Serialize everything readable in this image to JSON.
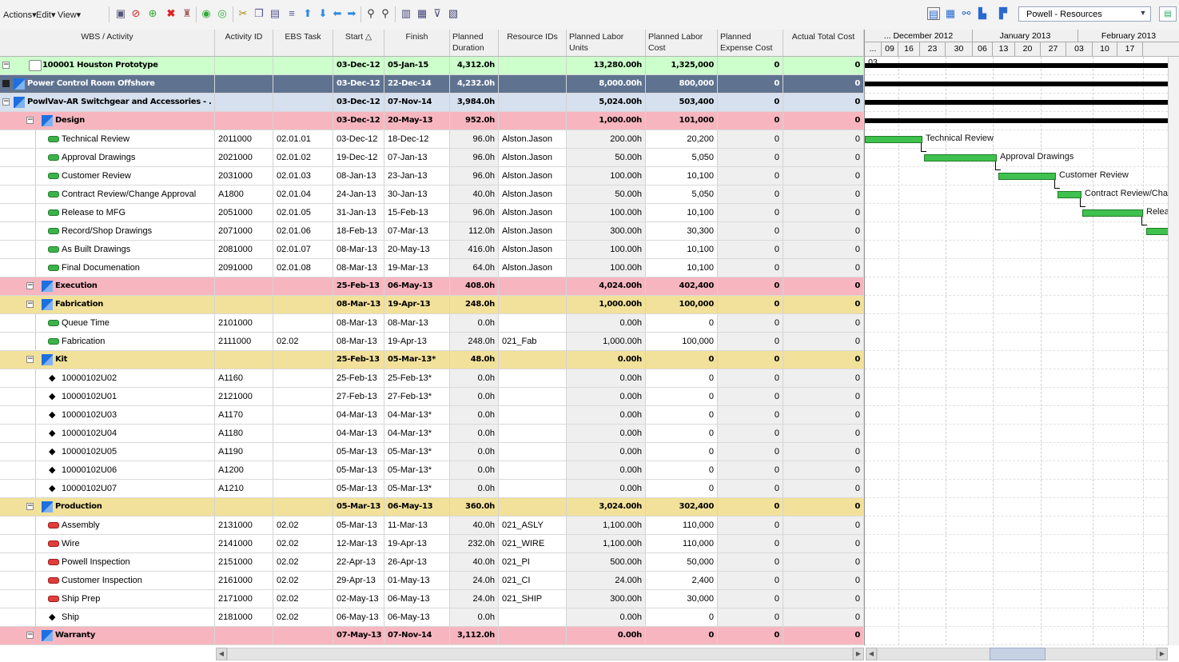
{
  "toolbar": {
    "menus": [
      "Actions",
      "Edit",
      "View"
    ],
    "layout_name": "Powell - Resources"
  },
  "colors": {
    "project_row": "#ccffcc",
    "level1_row": "#5f7390",
    "level2_row": "#d6e0ee",
    "phase_row": "#f7b6bf",
    "subphase_row": "#f2e19a",
    "bar_green": "#3fc24d",
    "milestone": "#000000"
  },
  "columns": [
    "WBS / Activity",
    "Activity ID",
    "EBS Task",
    "Start △",
    "Finish",
    "Planned Duration",
    "Resource IDs",
    "Planned Labor Units",
    "Planned Labor Cost",
    "Planned Expense Cost",
    "Actual Total Cost"
  ],
  "rows": [
    {
      "kind": "project",
      "name": "100001 Houston Prototype",
      "id": "",
      "ebs": "",
      "start": "03-Dec-12",
      "finish": "05-Jan-15",
      "dur": "4,312.0h",
      "res": "",
      "units": "13,280.00h",
      "cost": "1,325,000",
      "exp": "0",
      "act": "0"
    },
    {
      "kind": "level1",
      "name": "Power Control Room Offshore",
      "id": "",
      "ebs": "",
      "start": "03-Dec-12",
      "finish": "22-Dec-14",
      "dur": "4,232.0h",
      "res": "",
      "units": "8,000.00h",
      "cost": "800,000",
      "exp": "0",
      "act": "0"
    },
    {
      "kind": "level2",
      "name": "PowlVav-AR Switchgear and Accessories - ...",
      "id": "",
      "ebs": "",
      "start": "03-Dec-12",
      "finish": "07-Nov-14",
      "dur": "3,984.0h",
      "res": "",
      "units": "5,024.00h",
      "cost": "503,400",
      "exp": "0",
      "act": "0"
    },
    {
      "kind": "phase",
      "name": "Design",
      "id": "",
      "ebs": "",
      "start": "03-Dec-12",
      "finish": "20-May-13",
      "dur": "952.0h",
      "res": "",
      "units": "1,000.00h",
      "cost": "101,000",
      "exp": "0",
      "act": "0"
    },
    {
      "kind": "task-green",
      "name": "Technical Review",
      "id": "2011000",
      "ebs": "02.01.01",
      "start": "03-Dec-12",
      "finish": "18-Dec-12",
      "dur": "96.0h",
      "res": "Alston.Jason",
      "units": "200.00h",
      "cost": "20,200",
      "exp": "0",
      "act": "0"
    },
    {
      "kind": "task-green",
      "name": "Approval Drawings",
      "id": "2021000",
      "ebs": "02.01.02",
      "start": "19-Dec-12",
      "finish": "07-Jan-13",
      "dur": "96.0h",
      "res": "Alston.Jason",
      "units": "50.00h",
      "cost": "5,050",
      "exp": "0",
      "act": "0"
    },
    {
      "kind": "task-green",
      "name": "Customer Review",
      "id": "2031000",
      "ebs": "02.01.03",
      "start": "08-Jan-13",
      "finish": "23-Jan-13",
      "dur": "96.0h",
      "res": "Alston.Jason",
      "units": "100.00h",
      "cost": "10,100",
      "exp": "0",
      "act": "0"
    },
    {
      "kind": "task-green",
      "name": "Contract Review/Change Approval",
      "id": "A1800",
      "ebs": "02.01.04",
      "start": "24-Jan-13",
      "finish": "30-Jan-13",
      "dur": "40.0h",
      "res": "Alston.Jason",
      "units": "50.00h",
      "cost": "5,050",
      "exp": "0",
      "act": "0"
    },
    {
      "kind": "task-green",
      "name": "Release to MFG",
      "id": "2051000",
      "ebs": "02.01.05",
      "start": "31-Jan-13",
      "finish": "15-Feb-13",
      "dur": "96.0h",
      "res": "Alston.Jason",
      "units": "100.00h",
      "cost": "10,100",
      "exp": "0",
      "act": "0"
    },
    {
      "kind": "task-green",
      "name": "Record/Shop Drawings",
      "id": "2071000",
      "ebs": "02.01.06",
      "start": "18-Feb-13",
      "finish": "07-Mar-13",
      "dur": "112.0h",
      "res": "Alston.Jason",
      "units": "300.00h",
      "cost": "30,300",
      "exp": "0",
      "act": "0"
    },
    {
      "kind": "task-green",
      "name": "As Built Drawings",
      "id": "2081000",
      "ebs": "02.01.07",
      "start": "08-Mar-13",
      "finish": "20-May-13",
      "dur": "416.0h",
      "res": "Alston.Jason",
      "units": "100.00h",
      "cost": "10,100",
      "exp": "0",
      "act": "0"
    },
    {
      "kind": "task-green",
      "name": "Final Documenation",
      "id": "2091000",
      "ebs": "02.01.08",
      "start": "08-Mar-13",
      "finish": "19-Mar-13",
      "dur": "64.0h",
      "res": "Alston.Jason",
      "units": "100.00h",
      "cost": "10,100",
      "exp": "0",
      "act": "0"
    },
    {
      "kind": "phase",
      "name": "Execution",
      "id": "",
      "ebs": "",
      "start": "25-Feb-13",
      "finish": "06-May-13",
      "dur": "408.0h",
      "res": "",
      "units": "4,024.00h",
      "cost": "402,400",
      "exp": "0",
      "act": "0"
    },
    {
      "kind": "subphase",
      "name": "Fabrication",
      "id": "",
      "ebs": "",
      "start": "08-Mar-13",
      "finish": "19-Apr-13",
      "dur": "248.0h",
      "res": "",
      "units": "1,000.00h",
      "cost": "100,000",
      "exp": "0",
      "act": "0"
    },
    {
      "kind": "task-green",
      "name": "Queue Time",
      "id": "2101000",
      "ebs": "",
      "start": "08-Mar-13",
      "finish": "08-Mar-13",
      "dur": "0.0h",
      "res": "",
      "units": "0.00h",
      "cost": "0",
      "exp": "0",
      "act": "0"
    },
    {
      "kind": "task-green",
      "name": "Fabrication",
      "id": "2111000",
      "ebs": "02.02",
      "start": "08-Mar-13",
      "finish": "19-Apr-13",
      "dur": "248.0h",
      "res": "021_Fab",
      "units": "1,000.00h",
      "cost": "100,000",
      "exp": "0",
      "act": "0"
    },
    {
      "kind": "subphase",
      "name": "Kit",
      "id": "",
      "ebs": "",
      "start": "25-Feb-13",
      "finish": "05-Mar-13*",
      "dur": "48.0h",
      "res": "",
      "units": "0.00h",
      "cost": "0",
      "exp": "0",
      "act": "0"
    },
    {
      "kind": "milestone",
      "name": "10000102U02",
      "id": "A1160",
      "ebs": "",
      "start": "25-Feb-13",
      "finish": "25-Feb-13*",
      "dur": "0.0h",
      "res": "",
      "units": "0.00h",
      "cost": "0",
      "exp": "0",
      "act": "0"
    },
    {
      "kind": "milestone",
      "name": "10000102U01",
      "id": "2121000",
      "ebs": "",
      "start": "27-Feb-13",
      "finish": "27-Feb-13*",
      "dur": "0.0h",
      "res": "",
      "units": "0.00h",
      "cost": "0",
      "exp": "0",
      "act": "0"
    },
    {
      "kind": "milestone",
      "name": "10000102U03",
      "id": "A1170",
      "ebs": "",
      "start": "04-Mar-13",
      "finish": "04-Mar-13*",
      "dur": "0.0h",
      "res": "",
      "units": "0.00h",
      "cost": "0",
      "exp": "0",
      "act": "0"
    },
    {
      "kind": "milestone",
      "name": "10000102U04",
      "id": "A1180",
      "ebs": "",
      "start": "04-Mar-13",
      "finish": "04-Mar-13*",
      "dur": "0.0h",
      "res": "",
      "units": "0.00h",
      "cost": "0",
      "exp": "0",
      "act": "0"
    },
    {
      "kind": "milestone",
      "name": "10000102U05",
      "id": "A1190",
      "ebs": "",
      "start": "05-Mar-13",
      "finish": "05-Mar-13*",
      "dur": "0.0h",
      "res": "",
      "units": "0.00h",
      "cost": "0",
      "exp": "0",
      "act": "0"
    },
    {
      "kind": "milestone",
      "name": "10000102U06",
      "id": "A1200",
      "ebs": "",
      "start": "05-Mar-13",
      "finish": "05-Mar-13*",
      "dur": "0.0h",
      "res": "",
      "units": "0.00h",
      "cost": "0",
      "exp": "0",
      "act": "0"
    },
    {
      "kind": "milestone",
      "name": "10000102U07",
      "id": "A1210",
      "ebs": "",
      "start": "05-Mar-13",
      "finish": "05-Mar-13*",
      "dur": "0.0h",
      "res": "",
      "units": "0.00h",
      "cost": "0",
      "exp": "0",
      "act": "0"
    },
    {
      "kind": "subphase",
      "name": "Production",
      "id": "",
      "ebs": "",
      "start": "05-Mar-13",
      "finish": "06-May-13",
      "dur": "360.0h",
      "res": "",
      "units": "3,024.00h",
      "cost": "302,400",
      "exp": "0",
      "act": "0"
    },
    {
      "kind": "task-red",
      "name": "Assembly",
      "id": "2131000",
      "ebs": "02.02",
      "start": "05-Mar-13",
      "finish": "11-Mar-13",
      "dur": "40.0h",
      "res": "021_ASLY",
      "units": "1,100.00h",
      "cost": "110,000",
      "exp": "0",
      "act": "0"
    },
    {
      "kind": "task-red",
      "name": "Wire",
      "id": "2141000",
      "ebs": "02.02",
      "start": "12-Mar-13",
      "finish": "19-Apr-13",
      "dur": "232.0h",
      "res": "021_WIRE",
      "units": "1,100.00h",
      "cost": "110,000",
      "exp": "0",
      "act": "0"
    },
    {
      "kind": "task-red",
      "name": "Powell Inspection",
      "id": "2151000",
      "ebs": "02.02",
      "start": "22-Apr-13",
      "finish": "26-Apr-13",
      "dur": "40.0h",
      "res": "021_PI",
      "units": "500.00h",
      "cost": "50,000",
      "exp": "0",
      "act": "0"
    },
    {
      "kind": "task-red",
      "name": "Customer Inspection",
      "id": "2161000",
      "ebs": "02.02",
      "start": "29-Apr-13",
      "finish": "01-May-13",
      "dur": "24.0h",
      "res": "021_CI",
      "units": "24.00h",
      "cost": "2,400",
      "exp": "0",
      "act": "0"
    },
    {
      "kind": "task-red",
      "name": "Ship Prep",
      "id": "2171000",
      "ebs": "02.02",
      "start": "02-May-13",
      "finish": "06-May-13",
      "dur": "24.0h",
      "res": "021_SHIP",
      "units": "300.00h",
      "cost": "30,000",
      "exp": "0",
      "act": "0"
    },
    {
      "kind": "milestone",
      "name": "Ship",
      "id": "2181000",
      "ebs": "02.02",
      "start": "06-May-13",
      "finish": "06-May-13",
      "dur": "0.0h",
      "res": "",
      "units": "0.00h",
      "cost": "0",
      "exp": "0",
      "act": "0"
    },
    {
      "kind": "phase",
      "name": "Warranty",
      "id": "",
      "ebs": "",
      "start": "07-May-13",
      "finish": "07-Nov-14",
      "dur": "3,112.0h",
      "res": "",
      "units": "0.00h",
      "cost": "0",
      "exp": "0",
      "act": "0"
    }
  ],
  "gantt": {
    "months": [
      "... December 2012",
      "January 2013",
      "February 2013"
    ],
    "weeks": [
      "... 03",
      "09",
      "16",
      "23",
      "30",
      "06",
      "13",
      "20",
      "27",
      "03",
      "10",
      "17"
    ],
    "bar_labels": [
      "Technical Review",
      "Approval Drawings",
      "Customer Review",
      "Contract Review/Char",
      "Relea"
    ]
  }
}
